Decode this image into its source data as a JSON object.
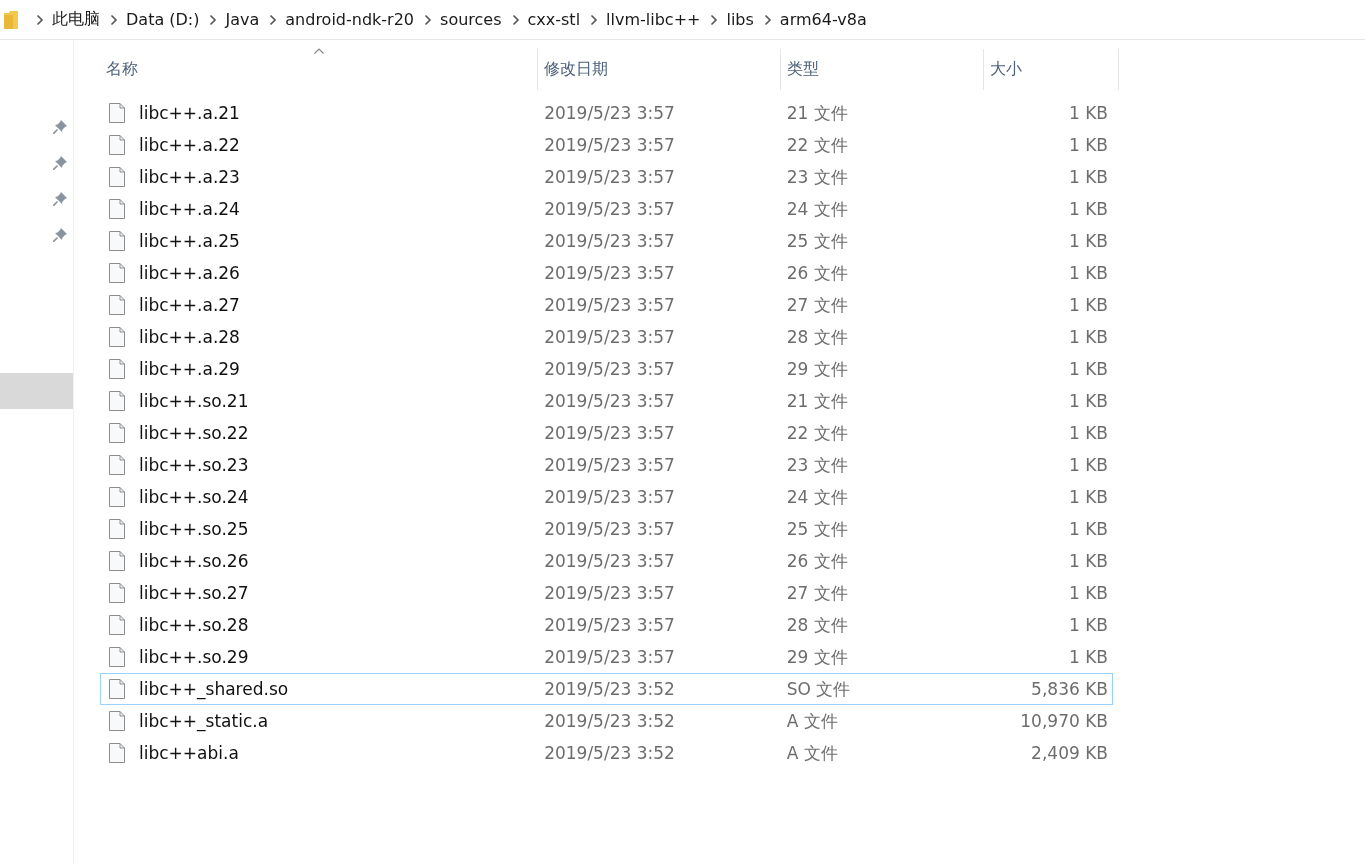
{
  "breadcrumb": [
    "此电脑",
    "Data (D:)",
    "Java",
    "android-ndk-r20",
    "sources",
    "cxx-stl",
    "llvm-libc++",
    "libs",
    "arm64-v8a"
  ],
  "nav_pane": {
    "items": [
      {
        "pinned": true,
        "selected": false
      },
      {
        "pinned": true,
        "selected": false
      },
      {
        "pinned": true,
        "selected": false
      },
      {
        "pinned": true,
        "selected": false
      },
      {
        "pinned": false,
        "selected": true
      }
    ]
  },
  "table": {
    "columns": [
      {
        "label": "名称",
        "sorted": true
      },
      {
        "label": "修改日期",
        "sorted": false
      },
      {
        "label": "类型",
        "sorted": false
      },
      {
        "label": "大小",
        "sorted": false
      }
    ],
    "rows": [
      {
        "name": "libc++.a.21",
        "date": "2019/5/23 3:57",
        "type": "21 文件",
        "size": "1 KB",
        "focused": false
      },
      {
        "name": "libc++.a.22",
        "date": "2019/5/23 3:57",
        "type": "22 文件",
        "size": "1 KB",
        "focused": false
      },
      {
        "name": "libc++.a.23",
        "date": "2019/5/23 3:57",
        "type": "23 文件",
        "size": "1 KB",
        "focused": false
      },
      {
        "name": "libc++.a.24",
        "date": "2019/5/23 3:57",
        "type": "24 文件",
        "size": "1 KB",
        "focused": false
      },
      {
        "name": "libc++.a.25",
        "date": "2019/5/23 3:57",
        "type": "25 文件",
        "size": "1 KB",
        "focused": false
      },
      {
        "name": "libc++.a.26",
        "date": "2019/5/23 3:57",
        "type": "26 文件",
        "size": "1 KB",
        "focused": false
      },
      {
        "name": "libc++.a.27",
        "date": "2019/5/23 3:57",
        "type": "27 文件",
        "size": "1 KB",
        "focused": false
      },
      {
        "name": "libc++.a.28",
        "date": "2019/5/23 3:57",
        "type": "28 文件",
        "size": "1 KB",
        "focused": false
      },
      {
        "name": "libc++.a.29",
        "date": "2019/5/23 3:57",
        "type": "29 文件",
        "size": "1 KB",
        "focused": false
      },
      {
        "name": "libc++.so.21",
        "date": "2019/5/23 3:57",
        "type": "21 文件",
        "size": "1 KB",
        "focused": false
      },
      {
        "name": "libc++.so.22",
        "date": "2019/5/23 3:57",
        "type": "22 文件",
        "size": "1 KB",
        "focused": false
      },
      {
        "name": "libc++.so.23",
        "date": "2019/5/23 3:57",
        "type": "23 文件",
        "size": "1 KB",
        "focused": false
      },
      {
        "name": "libc++.so.24",
        "date": "2019/5/23 3:57",
        "type": "24 文件",
        "size": "1 KB",
        "focused": false
      },
      {
        "name": "libc++.so.25",
        "date": "2019/5/23 3:57",
        "type": "25 文件",
        "size": "1 KB",
        "focused": false
      },
      {
        "name": "libc++.so.26",
        "date": "2019/5/23 3:57",
        "type": "26 文件",
        "size": "1 KB",
        "focused": false
      },
      {
        "name": "libc++.so.27",
        "date": "2019/5/23 3:57",
        "type": "27 文件",
        "size": "1 KB",
        "focused": false
      },
      {
        "name": "libc++.so.28",
        "date": "2019/5/23 3:57",
        "type": "28 文件",
        "size": "1 KB",
        "focused": false
      },
      {
        "name": "libc++.so.29",
        "date": "2019/5/23 3:57",
        "type": "29 文件",
        "size": "1 KB",
        "focused": false
      },
      {
        "name": "libc++_shared.so",
        "date": "2019/5/23 3:52",
        "type": "SO 文件",
        "size": "5,836 KB",
        "focused": true
      },
      {
        "name": "libc++_static.a",
        "date": "2019/5/23 3:52",
        "type": "A 文件",
        "size": "10,970 KB",
        "focused": false
      },
      {
        "name": "libc++abi.a",
        "date": "2019/5/23 3:52",
        "type": "A 文件",
        "size": "2,409 KB",
        "focused": false
      }
    ]
  }
}
